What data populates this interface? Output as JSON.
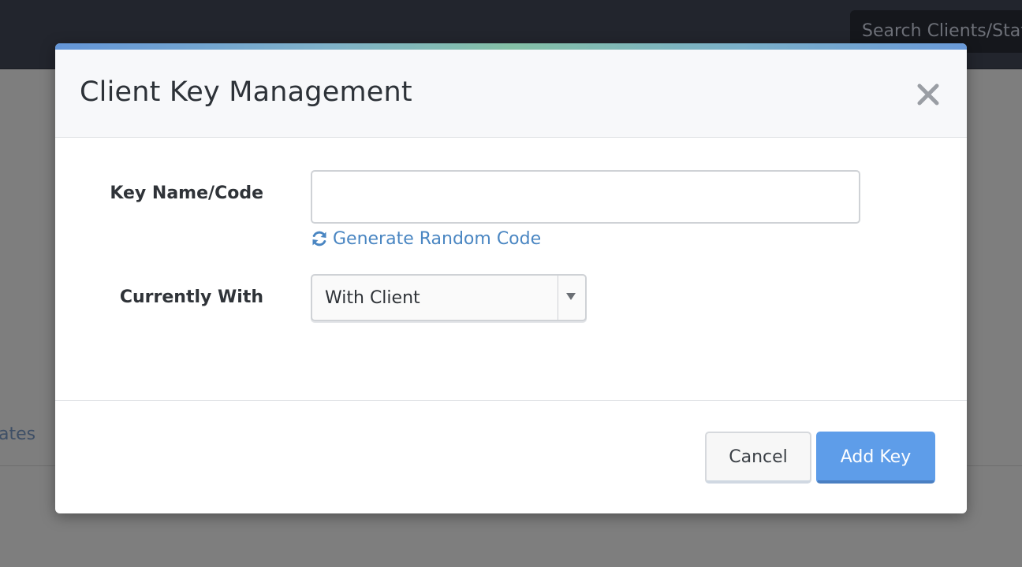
{
  "background": {
    "search_placeholder": "Search Clients/Stat",
    "partial_link": "ates"
  },
  "modal": {
    "title": "Client Key Management",
    "close_icon": "close-icon",
    "fields": {
      "key_name_label": "Key Name/Code",
      "key_name_value": "",
      "generate_link": "Generate Random Code",
      "generate_icon": "refresh-icon",
      "currently_with_label": "Currently With",
      "currently_with_value": "With Client"
    },
    "buttons": {
      "cancel": "Cancel",
      "add_key": "Add Key"
    }
  },
  "colors": {
    "primary": "#5e9de9",
    "link": "#4a86c2",
    "topbar": "#22252d"
  }
}
